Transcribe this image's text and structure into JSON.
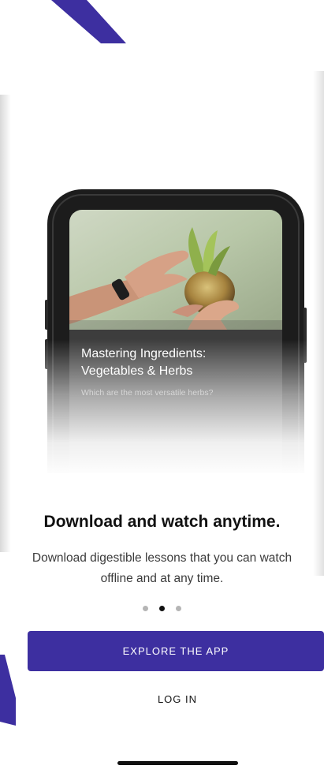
{
  "onboarding": {
    "lesson_card": {
      "title_line1": "Mastering Ingredients:",
      "title_line2": "Vegetables & Herbs",
      "description": "Which are the most versatile herbs?"
    },
    "headline": "Download and watch anytime.",
    "subtext": "Download digestible lessons that you can watch offline and at any time.",
    "pagination": {
      "total": 3,
      "active_index": 1
    },
    "explore_button": "EXPLORE THE APP",
    "login_button": "LOG IN"
  },
  "colors": {
    "brand_purple": "#3d2fa0",
    "text_dark": "#111111",
    "dot_inactive": "#b5b5b5"
  }
}
